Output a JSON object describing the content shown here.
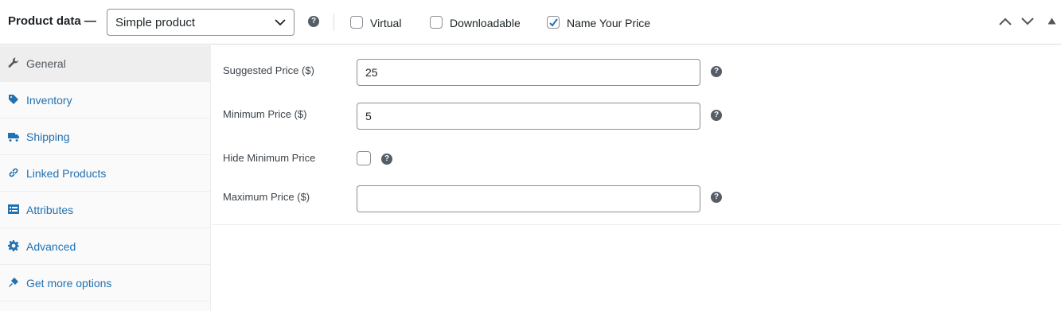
{
  "header": {
    "title": "Product data —",
    "product_type": "Simple product",
    "help_glyph": "?",
    "options": [
      {
        "label": "Virtual",
        "checked": false
      },
      {
        "label": "Downloadable",
        "checked": false
      },
      {
        "label": "Name Your Price",
        "checked": true
      }
    ]
  },
  "sidebar": {
    "tabs": [
      {
        "label": "General",
        "icon": "wrench-icon",
        "active": true
      },
      {
        "label": "Inventory",
        "icon": "tag-icon",
        "active": false
      },
      {
        "label": "Shipping",
        "icon": "truck-icon",
        "active": false
      },
      {
        "label": "Linked Products",
        "icon": "link-icon",
        "active": false
      },
      {
        "label": "Attributes",
        "icon": "list-icon",
        "active": false
      },
      {
        "label": "Advanced",
        "icon": "gear-icon",
        "active": false
      },
      {
        "label": "Get more options",
        "icon": "plugin-icon",
        "active": false
      }
    ]
  },
  "fields": {
    "suggested_price": {
      "label": "Suggested Price ($)",
      "value": "25"
    },
    "minimum_price": {
      "label": "Minimum Price ($)",
      "value": "5"
    },
    "hide_minimum": {
      "label": "Hide Minimum Price",
      "checked": false
    },
    "maximum_price": {
      "label": "Maximum Price ($)",
      "value": ""
    }
  },
  "colors": {
    "link": "#2271b1",
    "active_tab_bg": "#eeeeee",
    "help_icon": "#555d66"
  }
}
